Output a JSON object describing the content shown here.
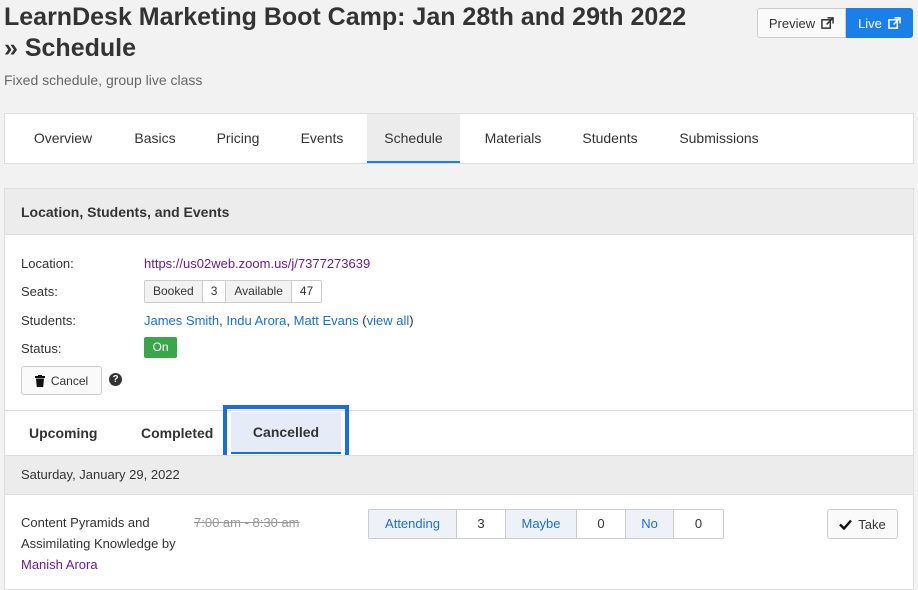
{
  "header": {
    "title": "LearnDesk Marketing Boot Camp: Jan 28th and 29th 2022 » Schedule",
    "subtitle": "Fixed schedule, group live class",
    "preview_label": "Preview",
    "live_label": "Live",
    "live_color": "#1a7fe8"
  },
  "tabs": [
    {
      "label": "Overview"
    },
    {
      "label": "Basics"
    },
    {
      "label": "Pricing"
    },
    {
      "label": "Events"
    },
    {
      "label": "Schedule",
      "active": true
    },
    {
      "label": "Materials"
    },
    {
      "label": "Students"
    },
    {
      "label": "Submissions"
    }
  ],
  "card": {
    "title": "Location, Students, and Events",
    "location_label": "Location:",
    "location_value": "https://us02web.zoom.us/j/7377273639",
    "seats_label": "Seats:",
    "seats": {
      "booked_label": "Booked",
      "booked": "3",
      "available_label": "Available",
      "available": "47"
    },
    "students_label": "Students:",
    "students": [
      "James Smith",
      "Indu Arora",
      "Matt Evans"
    ],
    "view_all": "view all",
    "status_label": "Status:",
    "status_value": "On",
    "status_color": "#3aa64a",
    "cancel_label": "Cancel",
    "help_icon": "question-circle-icon"
  },
  "subtabs": [
    {
      "label": "Upcoming"
    },
    {
      "label": "Completed"
    },
    {
      "label": "Cancelled",
      "active": true
    }
  ],
  "schedule": {
    "date": "Saturday, January 29, 2022",
    "session": {
      "title": "Content Pyramids and Assimilating Knowledge by",
      "instructor": "Manish Arora",
      "time": "7:00 am - 8:30 am",
      "attending_label": "Attending",
      "attending": "3",
      "maybe_label": "Maybe",
      "maybe": "0",
      "no_label": "No",
      "no": "0",
      "take_label": "Take"
    }
  }
}
